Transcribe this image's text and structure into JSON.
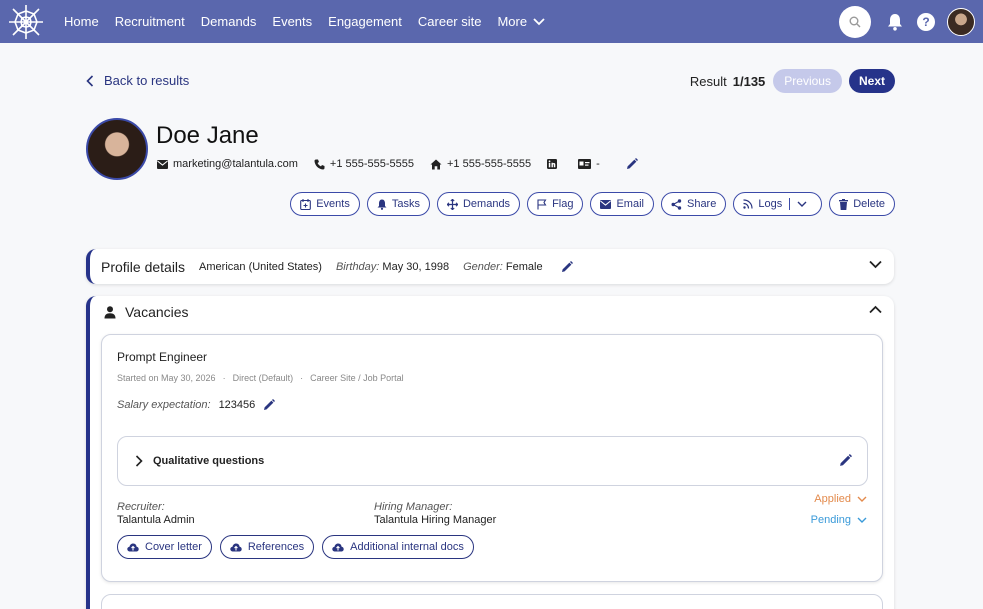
{
  "nav": {
    "items": [
      "Home",
      "Recruitment",
      "Demands",
      "Events",
      "Engagement",
      "Career site"
    ],
    "more": "More",
    "help": "?"
  },
  "header": {
    "back": "Back to results",
    "result_label": "Result",
    "result_count": "1/135",
    "previous": "Previous",
    "next": "Next"
  },
  "profile": {
    "name": "Doe Jane",
    "email": "marketing@talantula.com",
    "phone": "+1 555-555-5555",
    "home_phone": "+1 555-555-5555",
    "id_value": "-"
  },
  "actions": {
    "events": "Events",
    "tasks": "Tasks",
    "demands": "Demands",
    "flag": "Flag",
    "email": "Email",
    "share": "Share",
    "logs": "Logs",
    "delete": "Delete"
  },
  "details": {
    "title": "Profile details",
    "nationality": "American (United States)",
    "birthday_label": "Birthday:",
    "birthday": "May 30, 1998",
    "gender_label": "Gender:",
    "gender": "Female"
  },
  "vacancies": {
    "title": "Vacancies",
    "job": {
      "title": "Prompt Engineer",
      "started": "Started on May 30, 2026",
      "source": "Direct (Default)",
      "channel": "Career Site / Job Portal",
      "dot": "·",
      "salary_label": "Salary expectation:",
      "salary": "123456",
      "qualitative": "Qualitative questions",
      "recruiter_label": "Recruiter:",
      "recruiter": "Talantula Admin",
      "hm_label": "Hiring Manager:",
      "hm": "Talantula Hiring Manager",
      "status_applied": "Applied",
      "status_pending": "Pending",
      "docs": [
        "Cover letter",
        "References",
        "Additional internal docs"
      ]
    }
  },
  "colors": {
    "nav_bg": "#5a67ad",
    "primary": "#26338a",
    "applied": "#e38a4c",
    "pending": "#3a9ad9"
  }
}
